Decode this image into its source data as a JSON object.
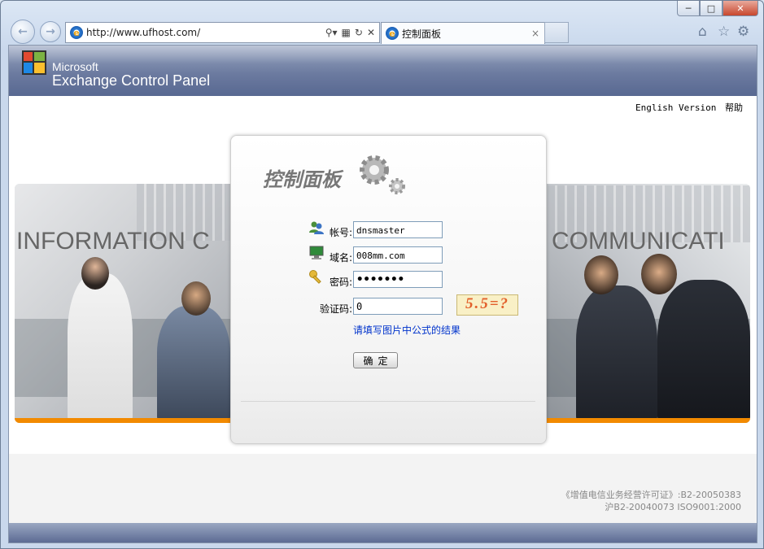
{
  "window": {
    "minimize_icon": "minimize-icon",
    "maximize_icon": "maximize-icon",
    "close_icon": "close-icon"
  },
  "toolbar": {
    "back_icon": "back-arrow-icon",
    "forward_icon": "forward-arrow-icon",
    "url": "http://www.ufhost.com/",
    "tab_title": "控制面板",
    "tab_close": "×",
    "right_icons": [
      "home-icon",
      "favorites-star-icon",
      "settings-gear-icon"
    ]
  },
  "header": {
    "brand_line1": "Microsoft",
    "brand_line2": "Exchange Control Panel",
    "link_english": "English Version",
    "link_help": "帮助"
  },
  "strip": {
    "left_text": "INFORMATION C",
    "right_text": "COMMUNICATI"
  },
  "login": {
    "title": "控制面板",
    "account_label": "帐号:",
    "account_value": "dnsmaster",
    "domain_label": "域名:",
    "domain_value": "008mm.com",
    "password_label": "密码:",
    "password_value": "•••••••",
    "captcha_label": "验证码:",
    "captcha_value": "0",
    "captcha_image_text": "5.5=?",
    "hint": "请填写图片中公式的结果",
    "submit_label": "确定"
  },
  "footer": {
    "license_line1": "《增值电信业务经营许可证》:B2-20050383",
    "license_line2": "沪B2-20040073 ISO9001:2000"
  },
  "colors": {
    "banner": "#6c7ba0",
    "accent_orange": "#f28a00",
    "hint_blue": "#0033cc"
  }
}
